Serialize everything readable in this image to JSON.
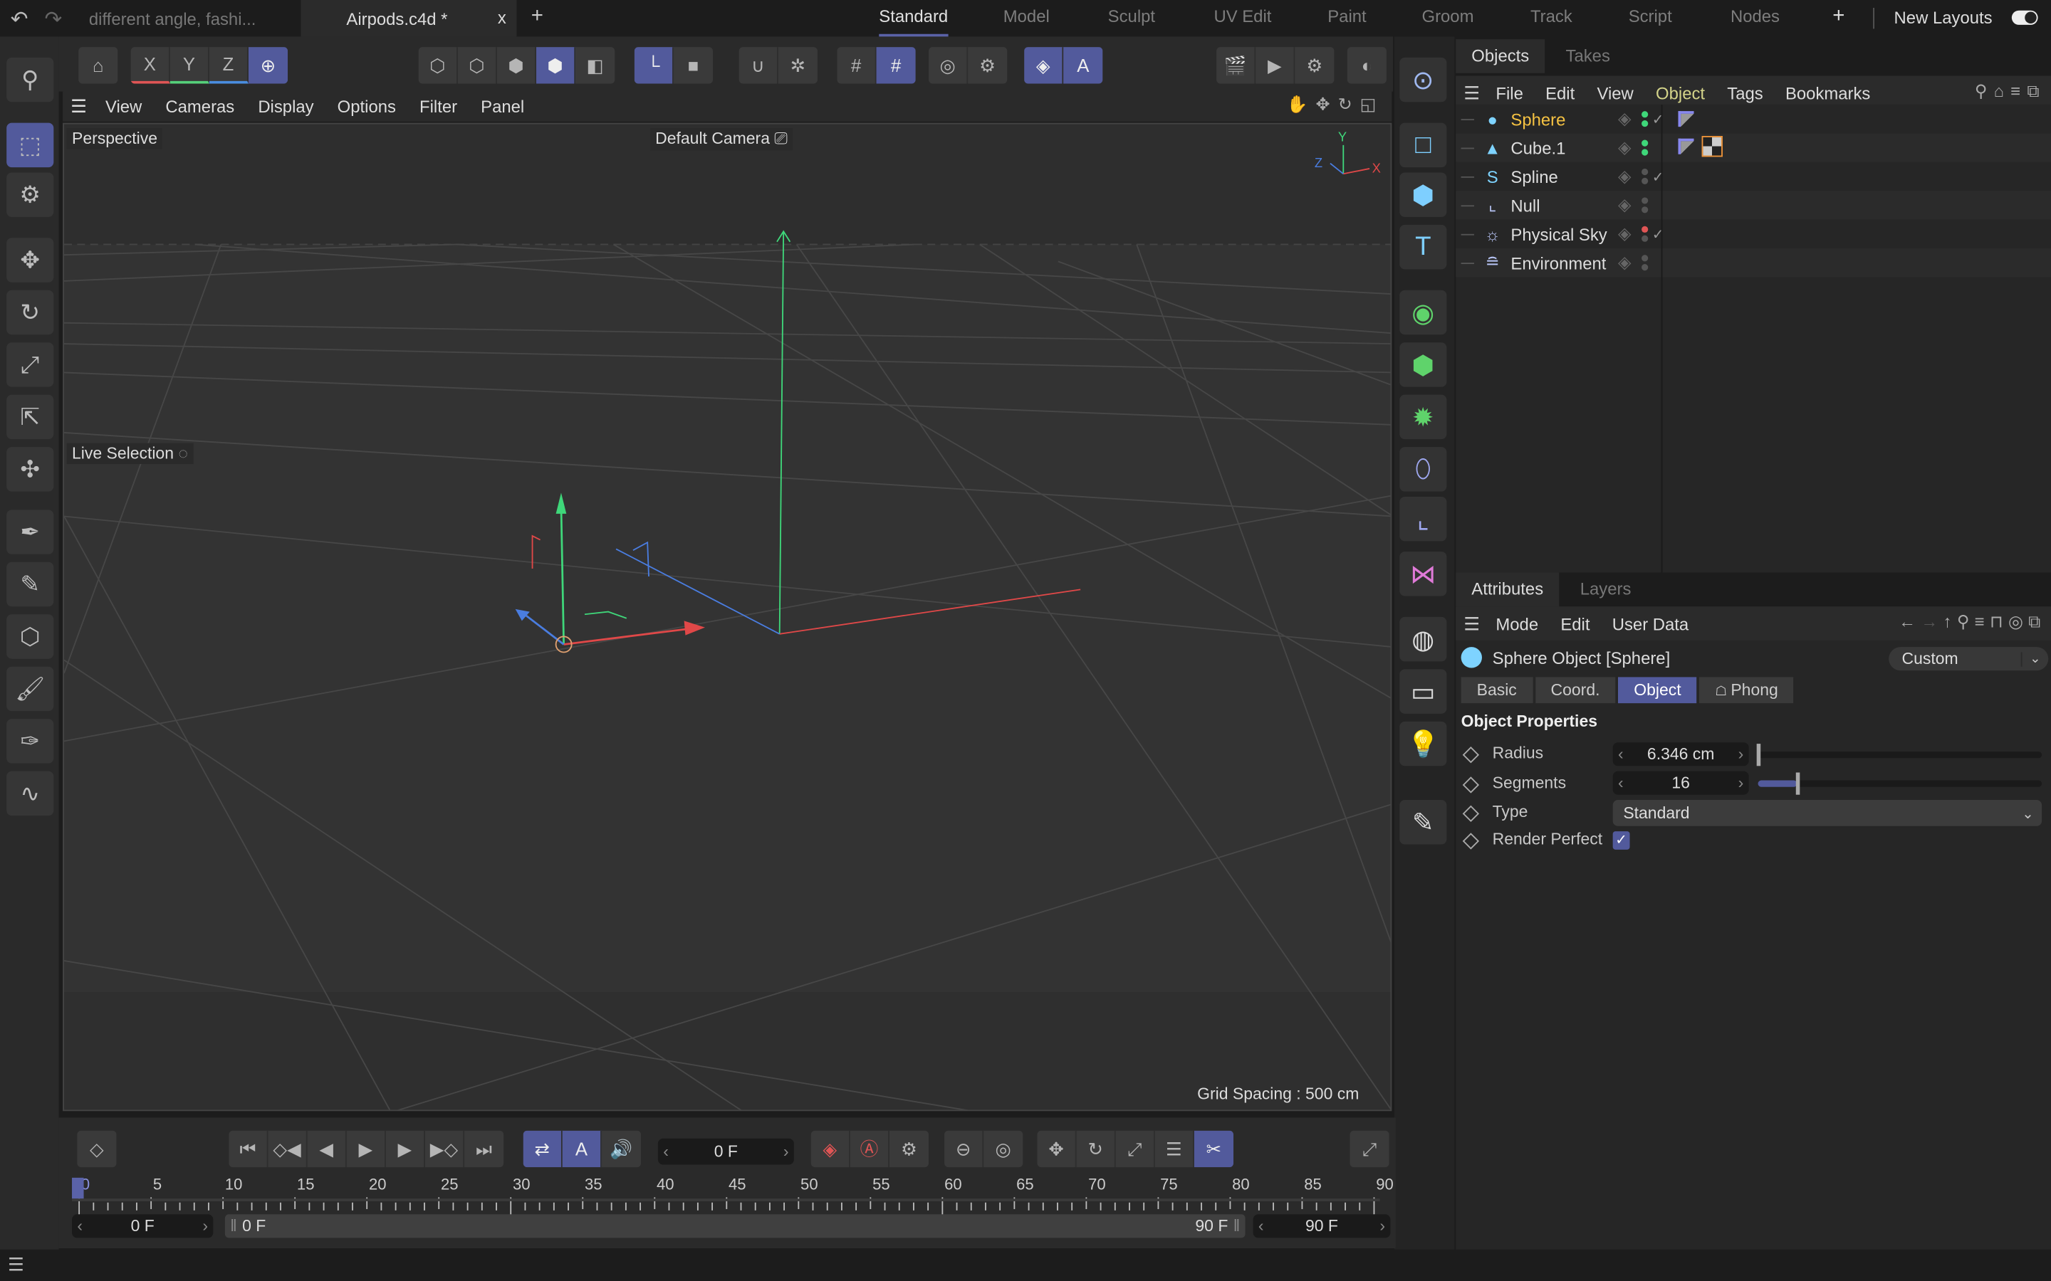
{
  "titlebar": {
    "doc_tabs": [
      {
        "label": "different angle, fashi...",
        "active": false
      },
      {
        "label": "Airpods.c4d *",
        "active": true
      }
    ],
    "close_glyph": "x",
    "new_tab_glyph": "+",
    "layouts": [
      "Standard",
      "Model",
      "Sculpt",
      "UV Edit",
      "Paint",
      "Groom",
      "Track",
      "Script",
      "Nodes"
    ],
    "active_layout": "Standard",
    "add_layout_glyph": "+",
    "new_layouts_label": "New Layouts"
  },
  "toolbar": {
    "groups": [
      [
        {
          "icon": "render-view-icon",
          "glyph": "⌂"
        }
      ],
      [
        {
          "icon": "x-axis-lock-icon",
          "glyph": "X",
          "color": "#e05555"
        },
        {
          "icon": "y-axis-lock-icon",
          "glyph": "Y",
          "color": "#55d07a"
        },
        {
          "icon": "z-axis-lock-icon",
          "glyph": "Z",
          "color": "#4a8de0"
        },
        {
          "icon": "world-coordinates-icon",
          "glyph": "⊕",
          "on": true
        }
      ],
      [
        {
          "icon": "points-mode-icon",
          "glyph": "⬡"
        },
        {
          "icon": "edges-mode-icon",
          "glyph": "⬡"
        },
        {
          "icon": "polygons-mode-icon",
          "glyph": "⬢"
        },
        {
          "icon": "model-mode-icon",
          "glyph": "⬢",
          "on": true
        },
        {
          "icon": "texture-mode-icon",
          "glyph": "◧"
        }
      ],
      [
        {
          "icon": "axis-mode-icon",
          "glyph": "└",
          "on": true
        },
        {
          "icon": "workplane-icon",
          "glyph": "■"
        }
      ],
      [
        {
          "icon": "snap-icon",
          "glyph": "∪"
        },
        {
          "icon": "snap-settings-icon",
          "glyph": "✲"
        }
      ],
      [
        {
          "icon": "grid-icon",
          "glyph": "#"
        },
        {
          "icon": "grid-lock-icon",
          "glyph": "#",
          "on": true
        }
      ],
      [
        {
          "icon": "soft-selection-icon",
          "glyph": "◎"
        },
        {
          "icon": "symmetry-icon",
          "glyph": "⚙"
        }
      ],
      [
        {
          "icon": "viewport-solo-icon",
          "glyph": "◈",
          "on": true
        },
        {
          "icon": "auto-solo-icon",
          "glyph": "A",
          "on": true
        }
      ],
      [
        {
          "icon": "render-active-view-icon",
          "glyph": "🎬"
        },
        {
          "icon": "render-to-picture-viewer-icon",
          "glyph": "▶"
        },
        {
          "icon": "render-settings-icon",
          "glyph": "⚙"
        }
      ],
      [
        {
          "icon": "redshift-icon",
          "glyph": "◐"
        }
      ]
    ]
  },
  "left_tools": [
    {
      "icon": "search-icon",
      "glyph": "⚲"
    },
    {
      "icon": "live-selection-icon",
      "glyph": "⬚",
      "on": true
    },
    {
      "icon": "tweak-icon",
      "glyph": "⚙"
    },
    {
      "icon": "move-icon",
      "glyph": "✥"
    },
    {
      "icon": "rotate-icon",
      "glyph": "↻"
    },
    {
      "icon": "scale-icon",
      "glyph": "⤢"
    },
    {
      "icon": "transfer-icon",
      "glyph": "⇱"
    },
    {
      "icon": "multi-transform-icon",
      "glyph": "✣"
    },
    {
      "icon": "spline-pen-icon",
      "glyph": "✒"
    },
    {
      "icon": "spline-sketch-icon",
      "glyph": "✎"
    },
    {
      "icon": "polygon-pen-icon",
      "glyph": "⬡"
    },
    {
      "icon": "paint-brush-icon",
      "glyph": "🖌"
    },
    {
      "icon": "knife-icon",
      "glyph": "✑"
    },
    {
      "icon": "sculpt-icon",
      "glyph": "∿"
    }
  ],
  "viewport": {
    "menu": [
      "View",
      "Cameras",
      "Display",
      "Options",
      "Filter",
      "Panel"
    ],
    "view_name": "Perspective",
    "camera": "Default Camera",
    "tool_label": "Live Selection",
    "grid_spacing": "Grid Spacing : 500 cm",
    "axis_labels": {
      "x": "X",
      "y": "Y",
      "z": "Z"
    }
  },
  "right_tools": [
    {
      "icon": "null-object-icon",
      "glyph": "⊙",
      "color": "#9fb8f0"
    },
    {
      "icon": "spline-rectangle-icon",
      "glyph": "□",
      "color": "#7ecfff"
    },
    {
      "icon": "cube-icon",
      "glyph": "⬢",
      "color": "#7ecfff"
    },
    {
      "icon": "text-icon",
      "glyph": "T",
      "color": "#7ecfff"
    },
    {
      "icon": "subdivision-surface-icon",
      "glyph": "◉",
      "color": "#5fd36b"
    },
    {
      "icon": "cloner-icon",
      "glyph": "⬢",
      "color": "#5fd36b"
    },
    {
      "icon": "deformer-icon",
      "glyph": "✹",
      "color": "#5fd36b"
    },
    {
      "icon": "field-icon",
      "glyph": "⬯",
      "color": "#9fa8f0"
    },
    {
      "icon": "scene-nodes-icon",
      "glyph": "⌞",
      "color": "#9fa8f0"
    },
    {
      "icon": "volume-icon",
      "glyph": "⋈",
      "color": "#e07ad8"
    },
    {
      "icon": "environment-icon",
      "glyph": "◍",
      "color": "#dcdcdc"
    },
    {
      "icon": "camera-icon",
      "glyph": "▭",
      "color": "#dcdcdc"
    },
    {
      "icon": "light-icon",
      "glyph": "💡",
      "color": "#dcdcdc"
    },
    {
      "icon": "material-edit-icon",
      "glyph": "✎",
      "color": "#dcdcdc"
    }
  ],
  "objects_panel": {
    "tabs": [
      "Objects",
      "Takes"
    ],
    "menu": [
      "File",
      "Edit",
      "View",
      "Object",
      "Tags",
      "Bookmarks"
    ],
    "highlight_menu": "Object",
    "objects": [
      {
        "name": "Sphere",
        "icon": "sphere-icon",
        "glyph": "●",
        "icon_color": "#7ed3ff",
        "selected": true,
        "dots": [
          "#3fd77a",
          "#3fd77a"
        ],
        "check": true,
        "tags": [
          "phong-tag-icon"
        ]
      },
      {
        "name": "Cube.1",
        "icon": "cube-object-icon",
        "glyph": "▲",
        "icon_color": "#7ed3ff",
        "dots": [
          "#3fd77a",
          "#3fd77a"
        ],
        "check": false,
        "tags": [
          "phong-tag-icon",
          "material-tag-icon"
        ]
      },
      {
        "name": "Spline",
        "icon": "spline-icon",
        "glyph": "S",
        "icon_color": "#7ed3ff",
        "dots": [
          "#555",
          "#555"
        ],
        "check": true,
        "tags": []
      },
      {
        "name": "Null",
        "icon": "null-icon",
        "glyph": "⌞",
        "icon_color": "#b7c4f5",
        "dots": [
          "#555",
          "#555"
        ],
        "check": false,
        "tags": []
      },
      {
        "name": "Physical Sky",
        "icon": "physical-sky-icon",
        "glyph": "☼",
        "icon_color": "#b7c4f5",
        "dots": [
          "#e05555",
          "#555"
        ],
        "check": true,
        "tags": []
      },
      {
        "name": "Environment",
        "icon": "environment-icon",
        "glyph": "≘",
        "icon_color": "#b7c4f5",
        "dots": [
          "#555",
          "#555"
        ],
        "check": false,
        "tags": []
      }
    ]
  },
  "attributes_panel": {
    "tabs": [
      "Attributes",
      "Layers"
    ],
    "menu": [
      "Mode",
      "Edit",
      "User Data"
    ],
    "object_title": "Sphere Object [Sphere]",
    "preset": "Custom",
    "subtabs": [
      "Basic",
      "Coord.",
      "Object",
      "Phong"
    ],
    "active_subtab": "Object",
    "section": "Object Properties",
    "radius": {
      "label": "Radius",
      "value": "6.346 cm",
      "slider_fraction": 0.0
    },
    "segments": {
      "label": "Segments",
      "value": "16",
      "slider_fraction": 0.14
    },
    "type": {
      "label": "Type",
      "value": "Standard"
    },
    "render_perfect": {
      "label": "Render Perfect",
      "checked": true
    }
  },
  "timeline": {
    "current_frame": "0 F",
    "ruler_labels": [
      "0",
      "5",
      "10",
      "15",
      "20",
      "25",
      "30",
      "35",
      "40",
      "45",
      "50",
      "55",
      "60",
      "65",
      "70",
      "75",
      "80",
      "85",
      "90"
    ],
    "start": "0 F",
    "range_start": "0 F",
    "range_end": "90 F",
    "end": "90 F",
    "playhead_frame": 0,
    "max_frame": 90
  },
  "colors": {
    "accent": "#525a9c",
    "selected_object": "#f5c242",
    "menu_highlight": "#d4d48a",
    "x_axis": "#e04848",
    "y_axis": "#3fd77a",
    "z_axis": "#4a7de0"
  }
}
